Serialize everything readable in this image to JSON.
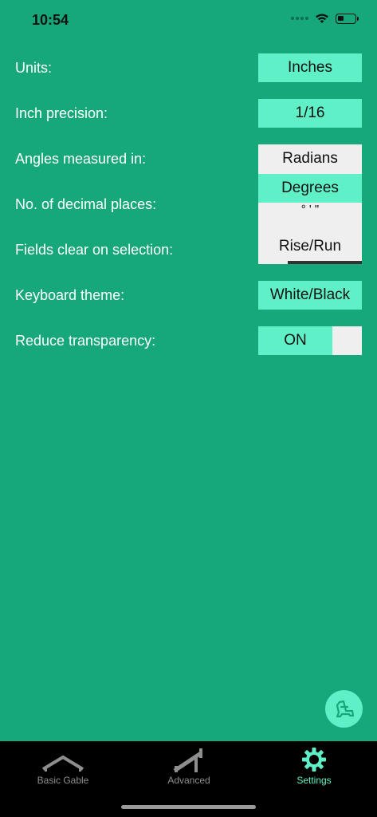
{
  "status_bar": {
    "time": "10:54"
  },
  "settings": {
    "units": {
      "label": "Units:",
      "value": "Inches"
    },
    "inch_precision": {
      "label": "Inch precision:",
      "value": "1/16"
    },
    "angles": {
      "label": "Angles measured in:",
      "options": [
        "Radians",
        "Degrees",
        "° ' \"",
        "Rise/Run"
      ],
      "selected": "Degrees"
    },
    "decimal_places": {
      "label": "No. of decimal places:"
    },
    "fields_clear": {
      "label": "Fields clear on selection:"
    },
    "keyboard_theme": {
      "label": "Keyboard theme:",
      "value": "White/Black"
    },
    "reduce_transparency": {
      "label": "Reduce transparency:",
      "value": "ON"
    }
  },
  "tab_bar": {
    "tabs": [
      {
        "label": "Basic Gable",
        "icon": "gable-roof-icon"
      },
      {
        "label": "Advanced",
        "icon": "advanced-roof-icon"
      },
      {
        "label": "Settings",
        "icon": "gear-icon"
      }
    ],
    "active": "Settings"
  },
  "colors": {
    "background": "#16a77a",
    "accent": "#5ff0c8",
    "tab_bar": "#000000",
    "inactive_tab": "#8e8e8e"
  }
}
